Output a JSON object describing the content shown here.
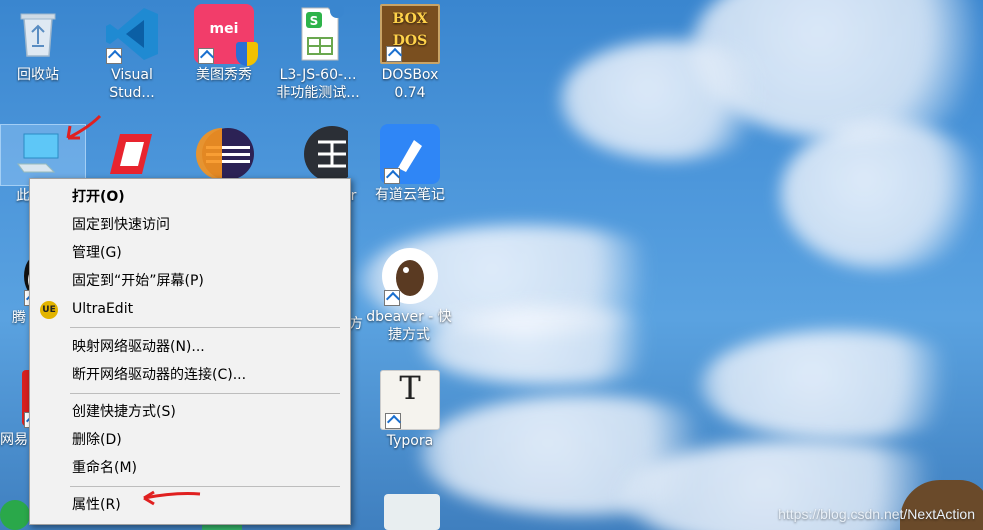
{
  "desktop_icons": [
    {
      "id": "recycle",
      "label": "回收站"
    },
    {
      "id": "vscode",
      "label": "Visual Stud..."
    },
    {
      "id": "meitu",
      "label": "美图秀秀"
    },
    {
      "id": "l3js",
      "label": "L3-JS-60-... 非功能测试..."
    },
    {
      "id": "dosbox",
      "label": "DOSBox 0.74"
    },
    {
      "id": "youdao",
      "label": "有道云笔记"
    },
    {
      "id": "dbeaver",
      "label": "dbeaver - 快捷方式"
    },
    {
      "id": "typora",
      "label": "Typora"
    }
  ],
  "partial_labels": {
    "this_pc_fragment": "此",
    "tencent_fragment": "腾",
    "netease_fragment": "网易",
    "xmind_fragment": "er",
    "eclipse_fragment": "方"
  },
  "context_menu": {
    "items": [
      {
        "label": "打开(O)",
        "bold": true
      },
      {
        "label": "固定到快速访问"
      },
      {
        "label": "管理(G)"
      },
      {
        "label": "固定到“开始”屏幕(P)"
      },
      {
        "label": "UltraEdit",
        "icon": "ultraedit-icon"
      },
      {
        "label": "映射网络驱动器(N)..."
      },
      {
        "label": "断开网络驱动器的连接(C)..."
      },
      {
        "label": "创建快捷方式(S)"
      },
      {
        "label": "删除(D)"
      },
      {
        "label": "重命名(M)"
      },
      {
        "label": "属性(R)"
      }
    ],
    "ultraedit_icon_text": "UE"
  },
  "dosbox_art": {
    "top": "BOX",
    "bottom": "DOS"
  },
  "typora_glyph": "T",
  "wps_glyph": "S",
  "meitu_glyph": "mei",
  "watermark": "https://blog.csdn.net/NextAction",
  "colors": {
    "sky": "#3a86cf",
    "menu_bg": "#f2f2f2",
    "annotation_red": "#e02020"
  }
}
